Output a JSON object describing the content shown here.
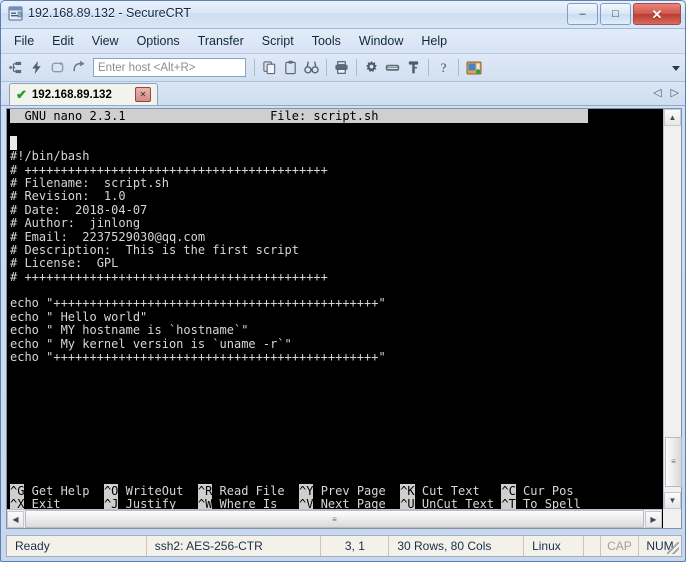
{
  "window": {
    "title": "192.168.89.132 - SecureCRT",
    "app_icon": "securecrt-icon",
    "minimize_glyph": "–",
    "maximize_glyph": "□",
    "close_glyph": "✕"
  },
  "menubar": {
    "items": [
      {
        "label": "File",
        "name": "menu-file"
      },
      {
        "label": "Edit",
        "name": "menu-edit"
      },
      {
        "label": "View",
        "name": "menu-view"
      },
      {
        "label": "Options",
        "name": "menu-options"
      },
      {
        "label": "Transfer",
        "name": "menu-transfer"
      },
      {
        "label": "Script",
        "name": "menu-script"
      },
      {
        "label": "Tools",
        "name": "menu-tools"
      },
      {
        "label": "Window",
        "name": "menu-window"
      },
      {
        "label": "Help",
        "name": "menu-help"
      }
    ]
  },
  "toolbar": {
    "host_placeholder": "Enter host <Alt+R>",
    "host_value": "",
    "buttons": [
      {
        "name": "new-session-icon",
        "glyph": "⎇"
      },
      {
        "name": "quick-connect-icon",
        "glyph": "⚡"
      },
      {
        "name": "reconnect-icon",
        "glyph": "⟳"
      },
      {
        "name": "disconnect-icon",
        "glyph": "⤳"
      },
      {
        "name": "copy-icon",
        "glyph": "❐"
      },
      {
        "name": "paste-icon",
        "glyph": "ὌB"
      },
      {
        "name": "find-icon",
        "glyph": "ὐE"
      },
      {
        "name": "print-icon",
        "glyph": "⎙"
      },
      {
        "name": "session-options-icon",
        "glyph": "⚙"
      },
      {
        "name": "keyboard-icon",
        "glyph": "⌨"
      },
      {
        "name": "key-icon",
        "glyph": "⚿"
      },
      {
        "name": "help-icon",
        "glyph": "?"
      },
      {
        "name": "session-manager-icon",
        "glyph": "ὛC"
      }
    ],
    "overflow_name": "toolbar-overflow-chevron"
  },
  "tabbar": {
    "tabs": [
      {
        "label": "192.168.89.132",
        "connected": true,
        "check_glyph": "✔",
        "close_glyph": "✕"
      }
    ],
    "nav_prev": "◁",
    "nav_next": "▷"
  },
  "terminal": {
    "nano_header_left": "  GNU nano 2.3.1",
    "nano_header_right": "File: script.sh",
    "lines": [
      "",
      "#!/bin/bash",
      "# ++++++++++++++++++++++++++++++++++++++++++",
      "# Filename:  script.sh",
      "# Revision:  1.0",
      "# Date:  2018-04-07",
      "# Author:  jinlong",
      "# Email:  2237529030@qq.com",
      "# Description:  This is the first script",
      "# License:  GPL",
      "# ++++++++++++++++++++++++++++++++++++++++++",
      "",
      "echo \"+++++++++++++++++++++++++++++++++++++++++++++\"",
      "echo \" Hello world\"",
      "echo \" MY hostname is `hostname`\"",
      "echo \" My kernel version is `uname -r`\"",
      "echo \"+++++++++++++++++++++++++++++++++++++++++++++\""
    ],
    "cursor_line_index": 0,
    "shortcuts": [
      {
        "key": "^G",
        "label": "Get Help"
      },
      {
        "key": "^O",
        "label": "WriteOut"
      },
      {
        "key": "^R",
        "label": "Read File"
      },
      {
        "key": "^Y",
        "label": "Prev Page"
      },
      {
        "key": "^K",
        "label": "Cut Text"
      },
      {
        "key": "^C",
        "label": "Cur Pos"
      },
      {
        "key": "^X",
        "label": "Exit"
      },
      {
        "key": "^J",
        "label": "Justify"
      },
      {
        "key": "^W",
        "label": "Where Is"
      },
      {
        "key": "^V",
        "label": "Next Page"
      },
      {
        "key": "^U",
        "label": "UnCut Text"
      },
      {
        "key": "^T",
        "label": "To Spell"
      }
    ],
    "scroll_up_glyph": "▲",
    "scroll_down_glyph": "▼",
    "scroll_left_glyph": "◀",
    "scroll_right_glyph": "▶",
    "thumb_grip": "≡"
  },
  "statusbar": {
    "ready": "Ready",
    "cipher": "ssh2: AES-256-CTR",
    "position": "3,  1",
    "dimensions": "30 Rows, 80 Cols",
    "emulation": "Linux",
    "spacer": "",
    "cap": "CAP",
    "num": "NUM"
  }
}
